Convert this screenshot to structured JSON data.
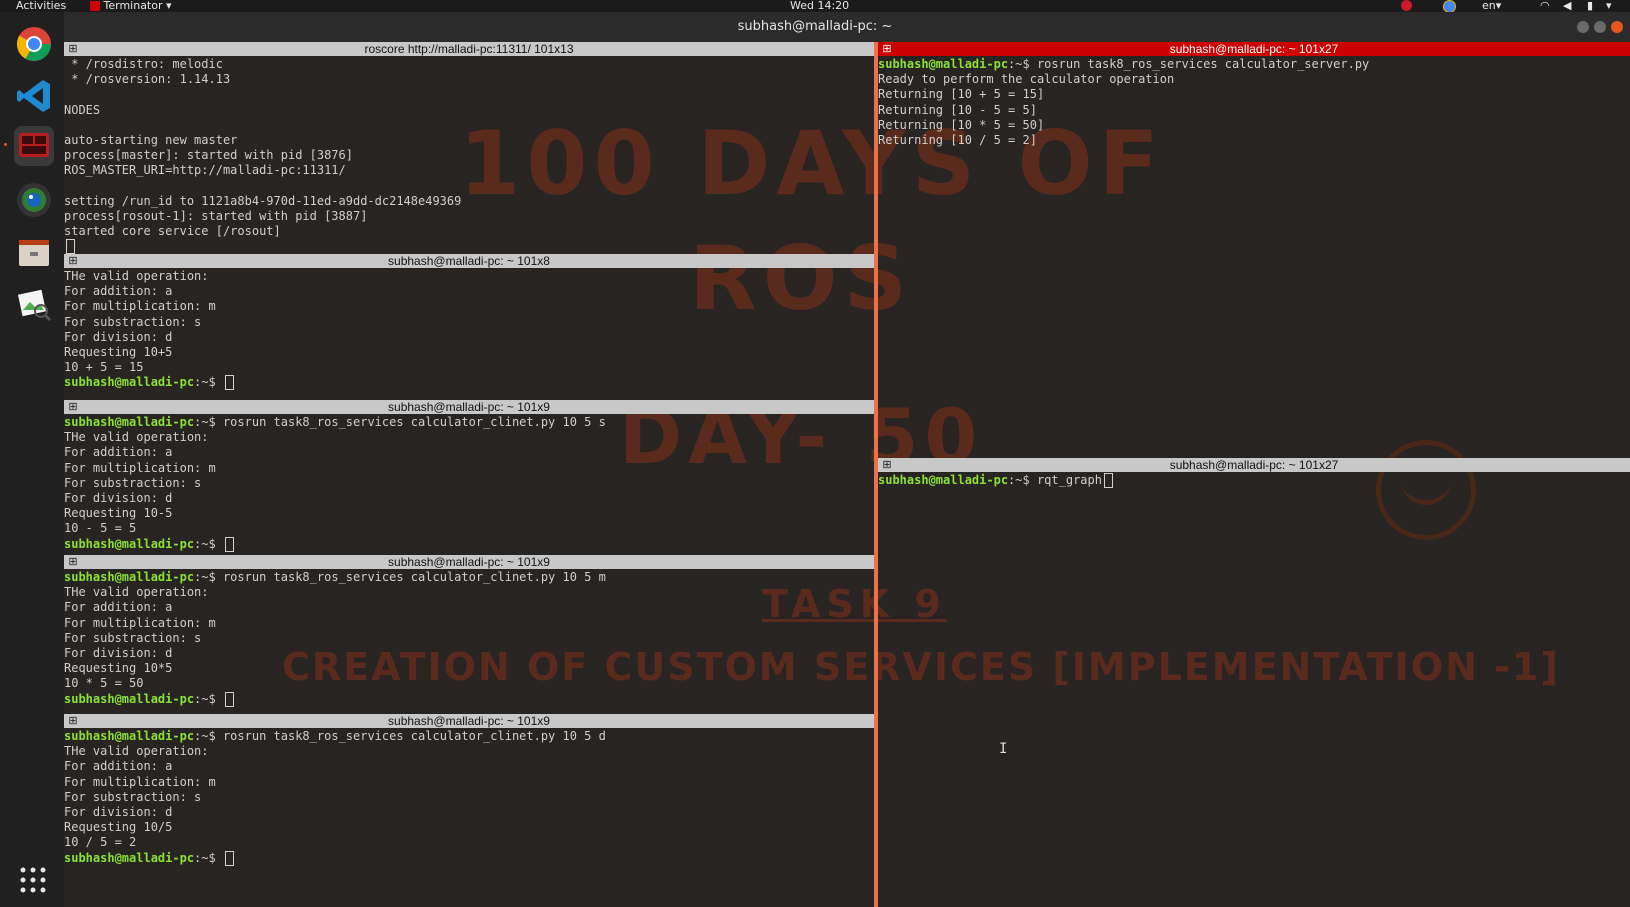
{
  "topbar": {
    "activities": "Activities",
    "app_menu": "Terminator",
    "clock": "Wed 14:20",
    "lang": "en"
  },
  "window": {
    "title": "subhash@malladi-pc: ~"
  },
  "dock": {
    "apps": [
      {
        "icon": "chrome-icon",
        "active": false
      },
      {
        "icon": "vscode-icon",
        "active": false
      },
      {
        "icon": "terminator-icon",
        "active": true
      },
      {
        "icon": "camera-icon",
        "active": false
      },
      {
        "icon": "files-icon",
        "active": false
      },
      {
        "icon": "image-viewer-icon",
        "active": false
      }
    ]
  },
  "watermark": {
    "line1": "100 DAYS OF",
    "line2": "ROS",
    "line3": "DAY- 50",
    "task": "TASK 9",
    "subtitle": "CREATION OF CUSTOM SERVICES [IMPLEMENTATION -1]"
  },
  "panes": {
    "roscore": {
      "title": "roscore http://malladi-pc:11311/ 101x13",
      "lines": [
        " * /rosdistro: melodic",
        " * /rosversion: 1.14.13",
        "",
        "NODES",
        "",
        "auto-starting new master",
        "process[master]: started with pid [3876]",
        "ROS_MASTER_URI=http://malladi-pc:11311/",
        "",
        "setting /run_id to 1121a8b4-970d-11ed-a9dd-dc2148e49369",
        "process[rosout-1]: started with pid [3887]",
        "started core service [/rosout]"
      ]
    },
    "client_add": {
      "title": "subhash@malladi-pc: ~ 101x8",
      "lines": [
        "THe valid operation:",
        "For addition: a",
        "For multiplication: m",
        "For substraction: s",
        "For division: d",
        "Requesting 10+5",
        "10 + 5 = 15"
      ],
      "prompt": "subhash@malladi-pc",
      "prompt_suffix": ":~$ "
    },
    "client_sub": {
      "title": "subhash@malladi-pc: ~ 101x9",
      "prompt": "subhash@malladi-pc",
      "prompt_suffix": ":~$ ",
      "command": "rosrun task8_ros_services calculator_clinet.py 10 5 s",
      "lines": [
        "THe valid operation:",
        "For addition: a",
        "For multiplication: m",
        "For substraction: s",
        "For division: d",
        "Requesting 10-5",
        "10 - 5 = 5"
      ]
    },
    "client_mul": {
      "title": "subhash@malladi-pc: ~ 101x9",
      "prompt": "subhash@malladi-pc",
      "prompt_suffix": ":~$ ",
      "command": "rosrun task8_ros_services calculator_clinet.py 10 5 m",
      "lines": [
        "THe valid operation:",
        "For addition: a",
        "For multiplication: m",
        "For substraction: s",
        "For division: d",
        "Requesting 10*5",
        "10 * 5 = 50"
      ]
    },
    "client_div": {
      "title": "subhash@malladi-pc: ~ 101x9",
      "prompt": "subhash@malladi-pc",
      "prompt_suffix": ":~$ ",
      "command": "rosrun task8_ros_services calculator_clinet.py 10 5 d",
      "lines": [
        "THe valid operation:",
        "For addition: a",
        "For multiplication: m",
        "For substraction: s",
        "For division: d",
        "Requesting 10/5",
        "10 / 5 = 2"
      ]
    },
    "server": {
      "title": "subhash@malladi-pc: ~ 101x27",
      "prompt": "subhash@malladi-pc",
      "prompt_suffix": ":~$ ",
      "command": "rosrun task8_ros_services calculator_server.py",
      "lines": [
        "Ready to perform the calculator operation",
        "Returning [10 + 5 = 15]",
        "Returning [10 - 5 = 5]",
        "Returning [10 * 5 = 50]",
        "Returning [10 / 5 = 2]"
      ]
    },
    "rqt": {
      "title": "subhash@malladi-pc: ~ 101x27",
      "prompt": "subhash@malladi-pc",
      "prompt_suffix": ":~$ ",
      "command": "rqt_graph"
    }
  },
  "colors": {
    "prompt": "#8ae234",
    "active_title": "#cc0000",
    "splitter": "#e8734a",
    "watermark": "#5a2a1c"
  }
}
